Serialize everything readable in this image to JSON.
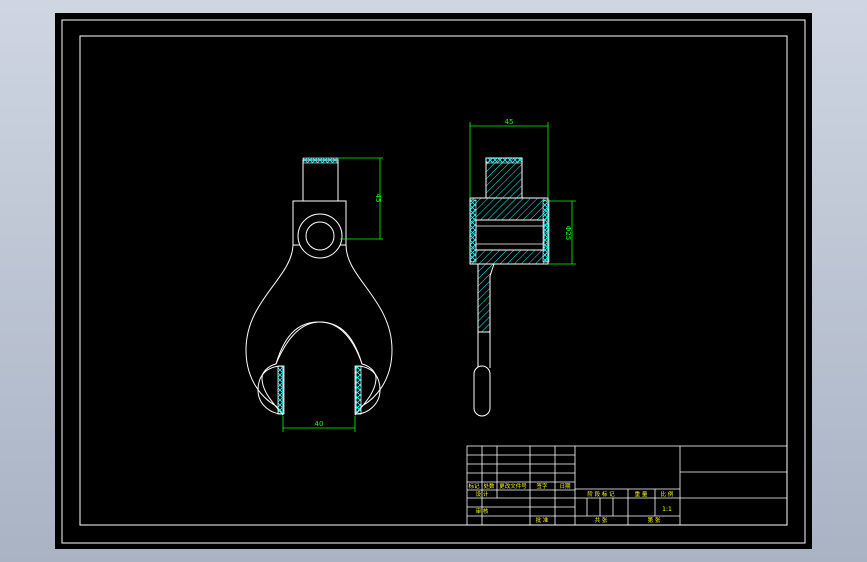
{
  "drawing": {
    "colors": {
      "background": "#000000",
      "frame": "#ffffff",
      "part_outline": "#ffffff",
      "dimension": "#00ff00",
      "hatch": "#00ffff",
      "title_text": "#ffff00"
    },
    "dimensions": {
      "front_width": "40",
      "front_height": "45",
      "side_width": "45",
      "side_height": "Φ25"
    },
    "title_block": {
      "row_labels": [
        "标记",
        "处数",
        "更改文件号",
        "签字",
        "日期"
      ],
      "design_label": "设 计",
      "stage_header": [
        "阶 段 标 记",
        "重 量",
        "比 例"
      ],
      "scale_value": "1:1",
      "review_label": "审 核",
      "approve_label": "批 准",
      "sheet_total": "共 张",
      "sheet_no": "第 张"
    }
  }
}
